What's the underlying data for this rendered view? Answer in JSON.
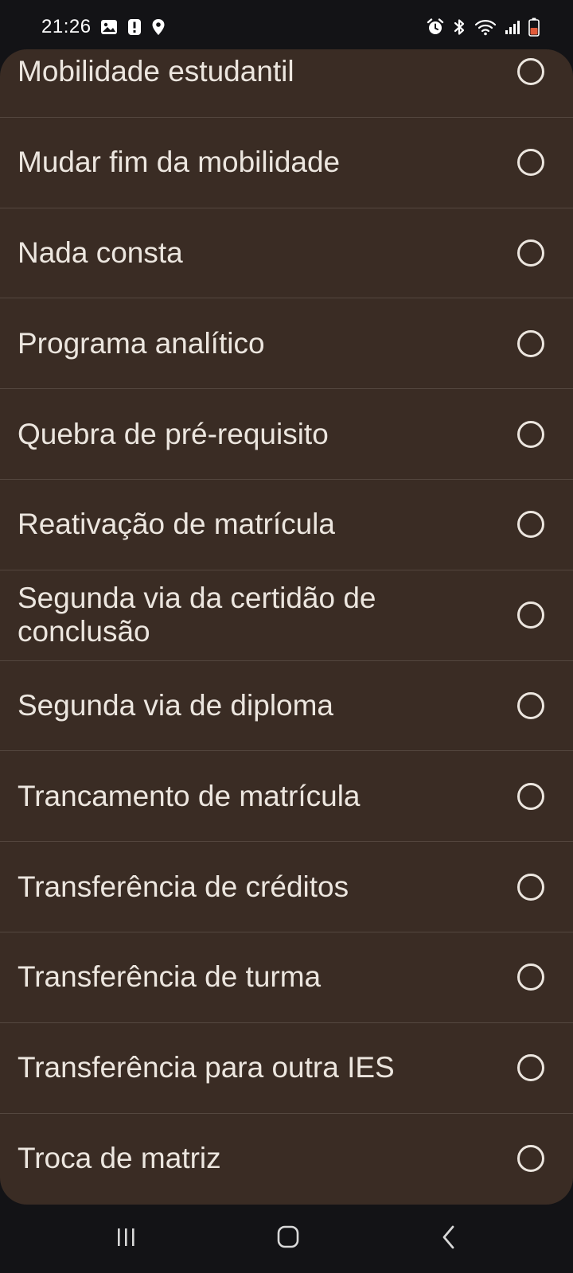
{
  "status_bar": {
    "time": "21:26",
    "left_icons": [
      "gallery-icon",
      "alert-icon",
      "location-icon"
    ],
    "right_icons": [
      "alarm-icon",
      "bluetooth-icon",
      "wifi-icon",
      "signal-icon",
      "battery-low-icon"
    ]
  },
  "options": [
    {
      "label": "Mobilidade estudantil",
      "selected": false
    },
    {
      "label": "Mudar fim da mobilidade",
      "selected": false
    },
    {
      "label": "Nada consta",
      "selected": false
    },
    {
      "label": "Programa analítico",
      "selected": false
    },
    {
      "label": "Quebra de pré-requisito",
      "selected": false
    },
    {
      "label": "Reativação de matrícula",
      "selected": false
    },
    {
      "label": "Segunda via da certidão de conclusão",
      "selected": false
    },
    {
      "label": "Segunda via de diploma",
      "selected": false
    },
    {
      "label": "Trancamento de matrícula",
      "selected": false
    },
    {
      "label": "Transferência de créditos",
      "selected": false
    },
    {
      "label": "Transferência de turma",
      "selected": false
    },
    {
      "label": "Transferência para outra IES",
      "selected": false
    },
    {
      "label": "Troca de matriz",
      "selected": false
    }
  ],
  "nav_bar": {
    "buttons": [
      "recents-icon",
      "home-icon",
      "back-icon"
    ]
  },
  "colors": {
    "sheet_background": "#3a2c24",
    "text": "#ece6df",
    "system_bars": "#131316",
    "divider": "#54473f",
    "battery": "#e05a3a"
  }
}
